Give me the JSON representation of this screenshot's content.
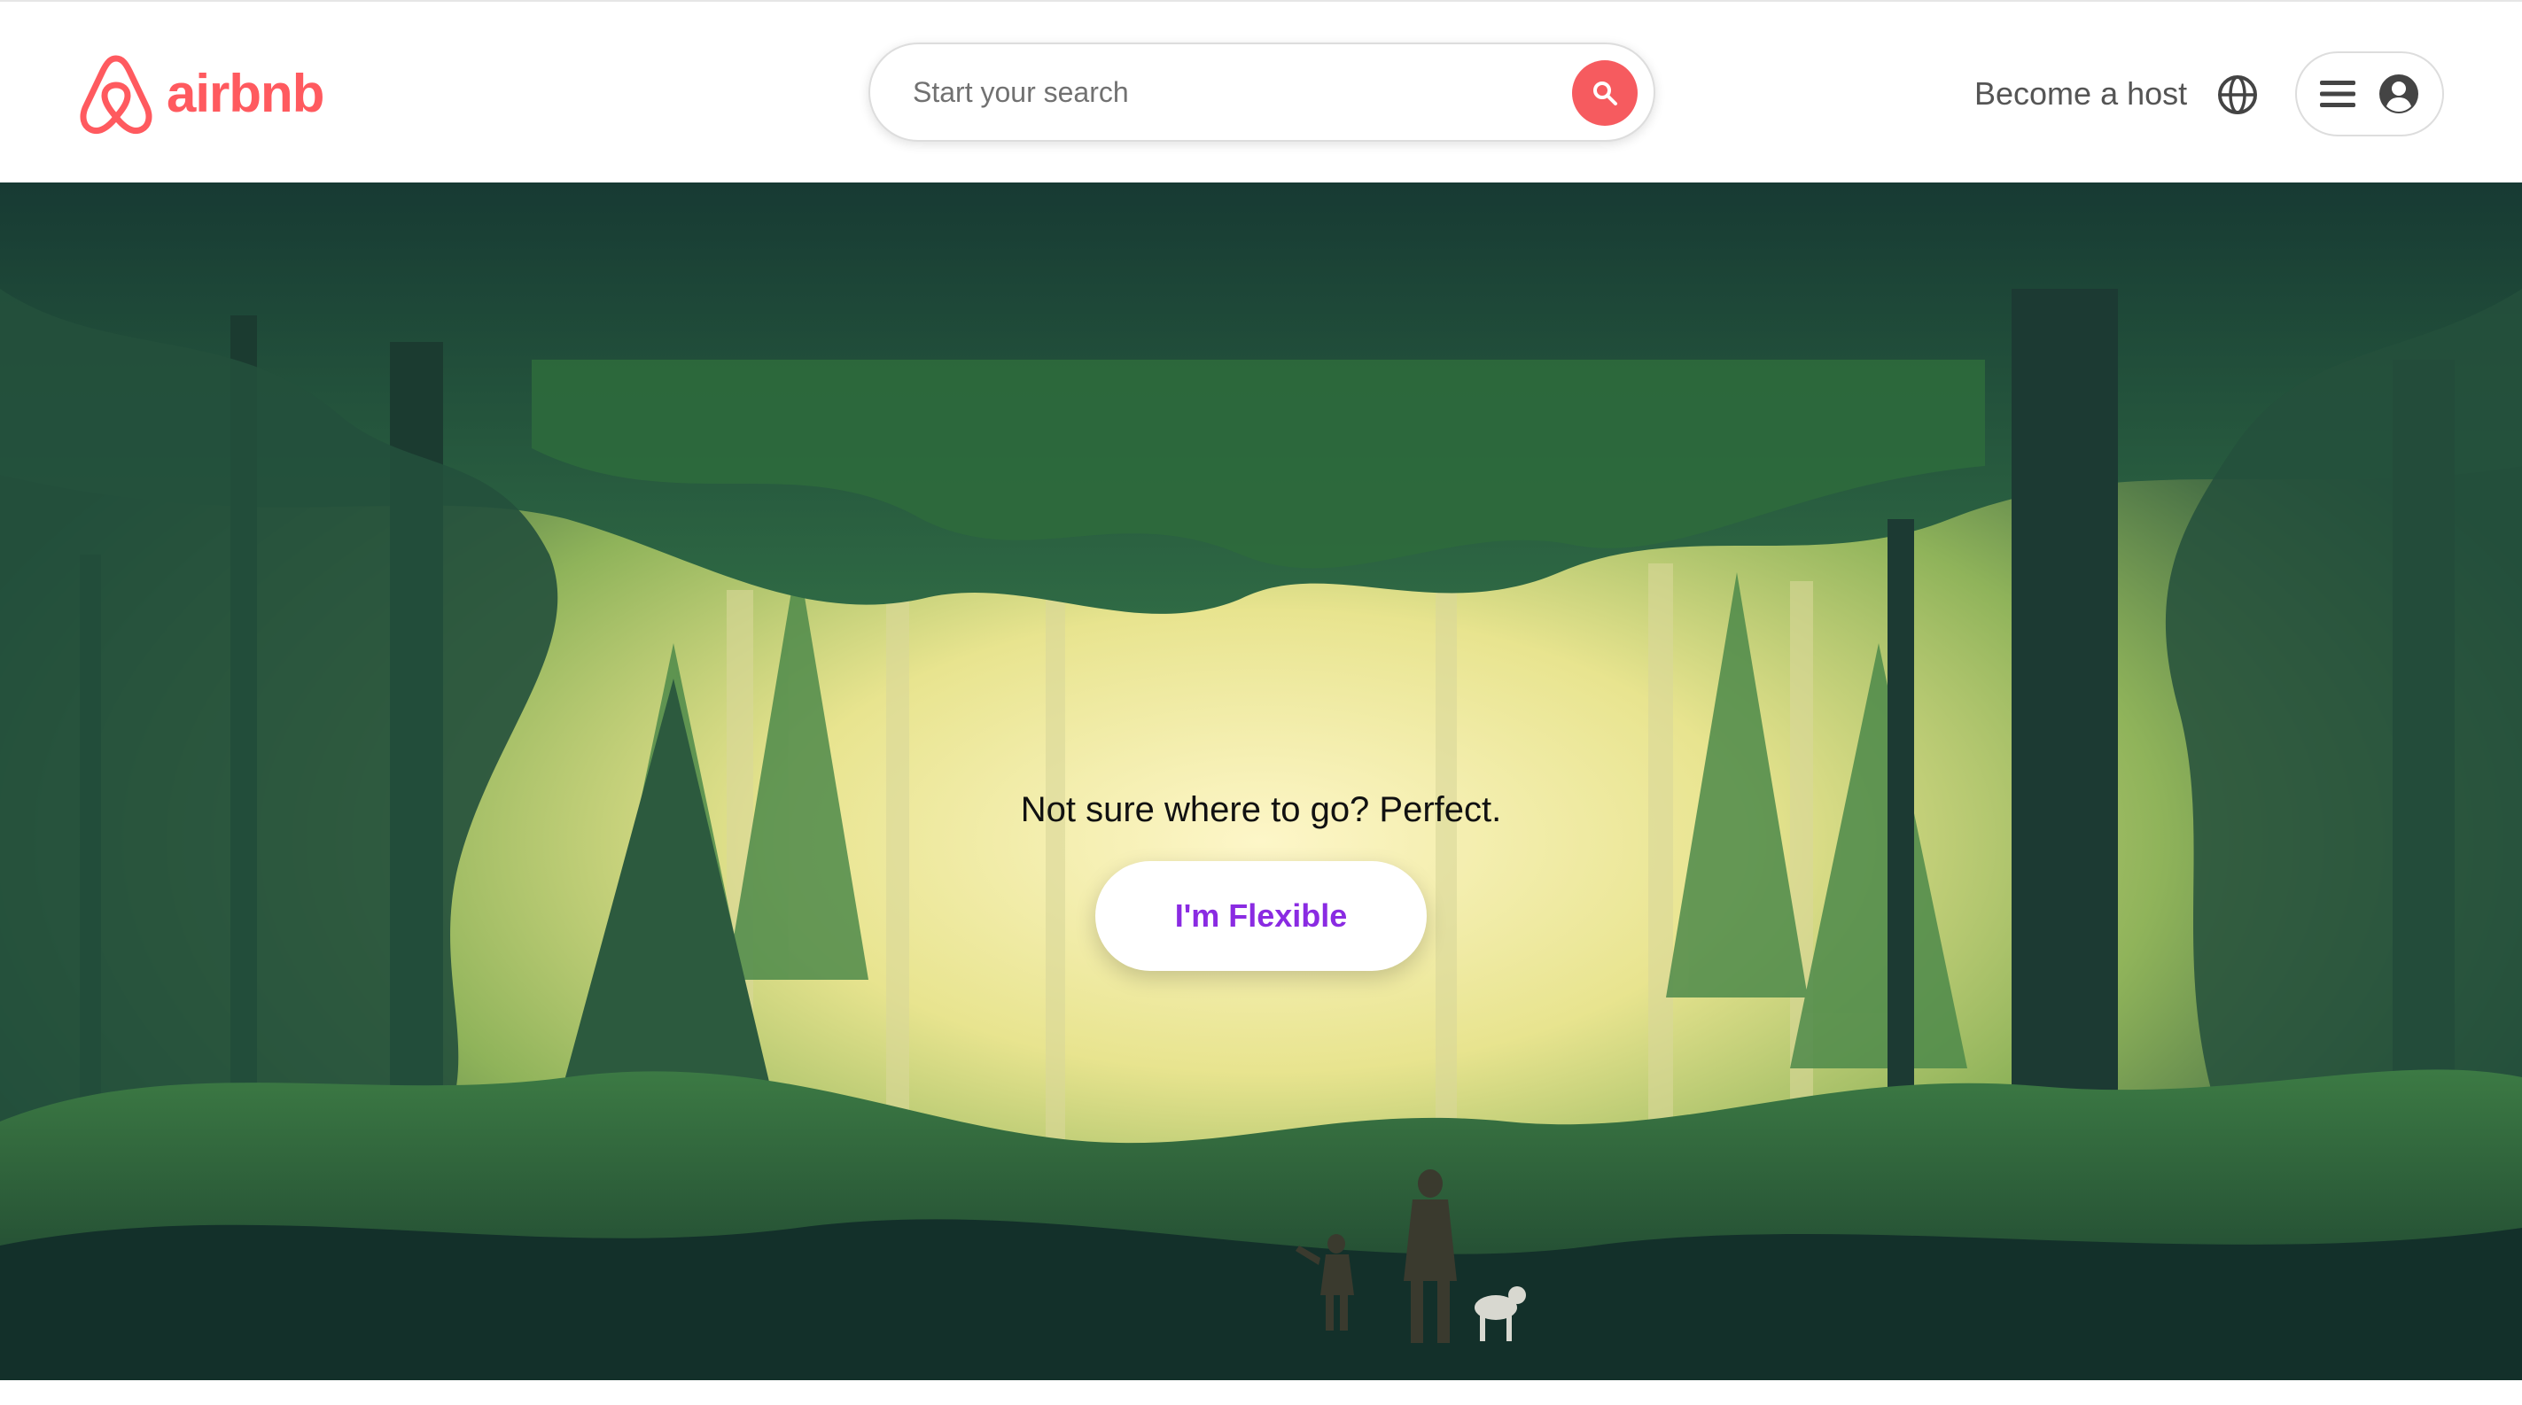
{
  "brand": {
    "name": "airbnb",
    "color": "#FF5A5F"
  },
  "search": {
    "placeholder": "Start your search",
    "button_icon": "search-icon",
    "button_color": "#F65B5F"
  },
  "nav": {
    "host_label": "Become a host",
    "language_icon": "globe-icon",
    "menu_icon": "hamburger-menu-icon",
    "profile_icon": "user-avatar-icon"
  },
  "hero": {
    "tagline": "Not sure where to go? Perfect.",
    "cta_label": "I'm Flexible",
    "cta_color": "#8A2BE2",
    "image_description_icon": "forest-illustration"
  }
}
